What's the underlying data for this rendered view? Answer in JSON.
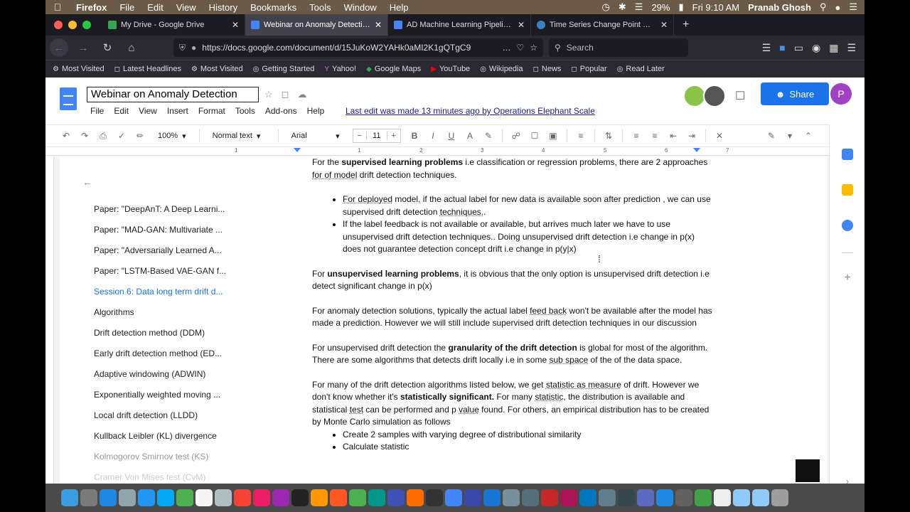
{
  "menubar": {
    "app": "Firefox",
    "items": [
      "File",
      "Edit",
      "View",
      "History",
      "Bookmarks",
      "Tools",
      "Window",
      "Help"
    ],
    "battery": "29%",
    "datetime": "Fri 9:10 AM",
    "user": "Pranab Ghosh"
  },
  "tabs": [
    {
      "title": "My Drive - Google Drive",
      "color": "#34a853"
    },
    {
      "title": "Webinar on Anomaly Detection",
      "color": "#4285f4"
    },
    {
      "title": "AD Machine Learning Pipeline -",
      "color": "#4285f4"
    },
    {
      "title": "Time Series Change Point Dete",
      "color": "#3b82c4"
    }
  ],
  "navbar": {
    "url": "https://docs.google.com/document/d/15JuKoW2YAHk0aMI2K1gQTgC9",
    "search_placeholder": "Search"
  },
  "bookmarks": [
    "Most Visited",
    "Latest Headlines",
    "Most Visited",
    "Getting Started",
    "Yahoo!",
    "Google Maps",
    "YouTube",
    "Wikipedia",
    "News",
    "Popular",
    "Read Later"
  ],
  "docs": {
    "title": "Webinar on Anomaly Detection",
    "menu": [
      "File",
      "Edit",
      "View",
      "Insert",
      "Format",
      "Tools",
      "Add-ons",
      "Help"
    ],
    "last_edit": "Last edit was made 13 minutes ago by Operations Elephant Scale",
    "share": "Share",
    "avatar_letter": "P"
  },
  "toolbar": {
    "zoom": "100%",
    "style": "Normal text",
    "font": "Arial",
    "font_size": "11",
    "minus": "−",
    "plus": "+"
  },
  "ruler_numbers": [
    "1",
    "1",
    "2",
    "3",
    "4",
    "5",
    "6",
    "7"
  ],
  "outline": [
    "Paper: \"DeepAnT: A Deep Learni...",
    "Paper: \"MAD-GAN: Multivariate ...",
    "Paper: \"Adversarially Learned A...",
    "Paper: \"LSTM-Based VAE-GAN f...",
    "Session 6: Data long term drift d...",
    "Algorithms",
    "Drift detection method (DDM)",
    "Early drift detection method (ED...",
    "Adaptive windowing (ADWIN)",
    "Exponentially weighted moving ...",
    "Local drift detection (LLDD)",
    "Kullback Leibler (KL) divergence",
    "Kolmogorov Smirnov test (KS)",
    "Cramer Von Mises test (CvM)"
  ],
  "body": {
    "p1_a": "For the ",
    "p1_b": "supervised learning problems",
    "p1_c": " i.e classification or regression problems, there are 2 approaches ",
    "p1_d": "for  of model",
    "p1_e": " drift detection techniques.",
    "b1_a": "For deployed",
    "b1_b": " model, if the actual label for new data is available soon after prediction , we can use supervised drift detection ",
    "b1_c": "techniques.",
    "b1_d": ".",
    "b2": "If the label feedback is not available  or available, but arrives much later we have to  use unsupervised drift detection techniques.. Doing unsupervised drift detection i.e change in p(x) does not guarantee detection concept drift i.e change in p(y|x)",
    "p2_a": "For ",
    "p2_b": "unsupervised learning problems",
    "p2_c": ", it is obvious that the only option is unsupervised drift detection i.e detect significant  change in p(x)",
    "p3_a": "For anomaly detection solutions, typically the actual label ",
    "p3_b": "feed back",
    "p3_c": " won't be available after the model has made a prediction. However we will still include supervised drift detection techniques in our discussion",
    "p4_a": "For unsupervised drift detection the ",
    "p4_b": "granularity of the drift detection",
    "p4_c": " is global for most of the algorithm. There are some algorithms that detects drift locally i.e in some ",
    "p4_d": "sub space",
    "p4_e": " of the of the data space.",
    "p5_a": "For many of the drift detection algorithms listed below, we get ",
    "p5_b": "statistic as measure",
    "p5_c": " of drift. However we don't know whether it's ",
    "p5_d": "statistically significant.",
    "p5_e": " For many ",
    "p5_f": "statistic",
    "p5_g": ", the distribution is available and statistical ",
    "p5_h": "test",
    "p5_i": " can be performed and p ",
    "p5_j": "value",
    "p5_k": " found. For others, an empirical distribution has to be created  by Monte Carlo simulation as follows",
    "b3": "Create 2  samples with varying degree of distributional similarity",
    "b4": "Calculate statistic"
  }
}
